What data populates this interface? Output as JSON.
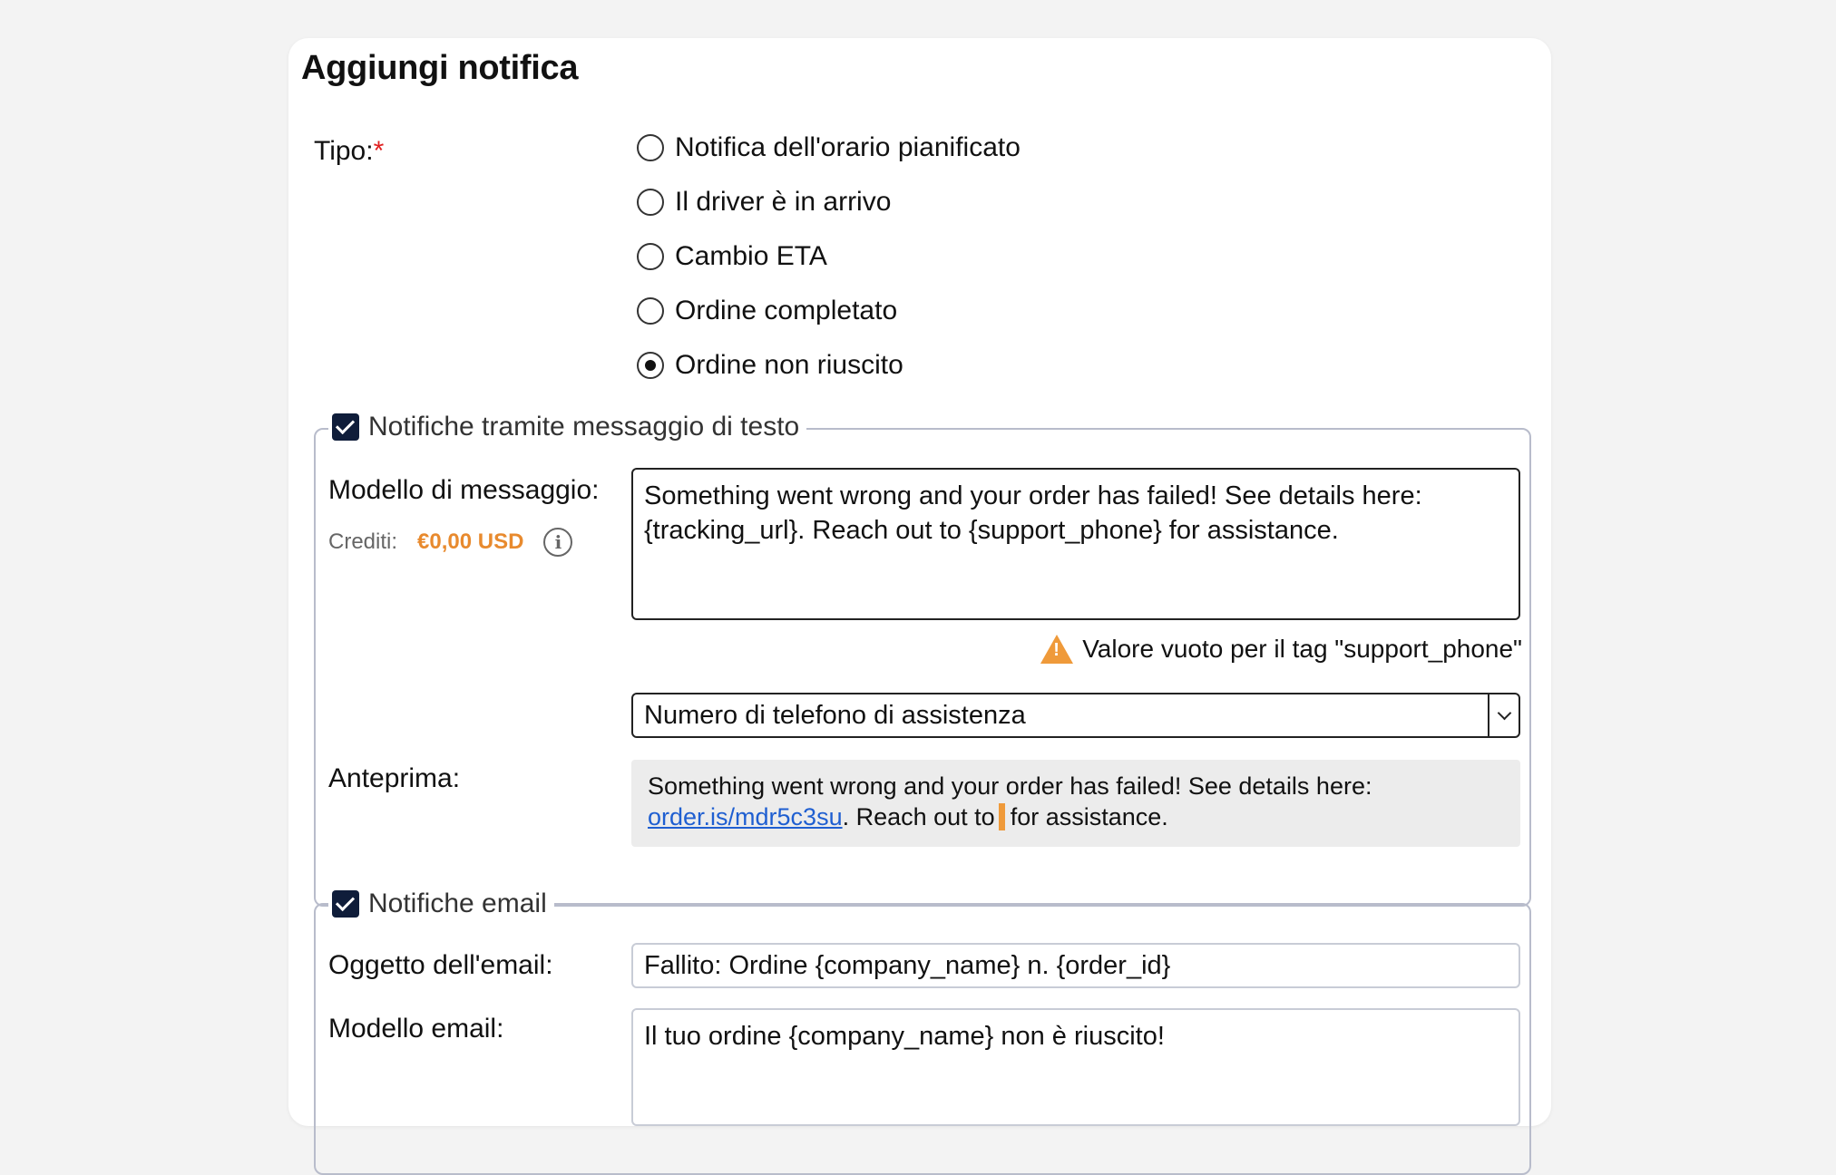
{
  "title": "Aggiungi notifica",
  "type_label": "Tipo:",
  "required_mark": "*",
  "types": [
    {
      "label": "Notifica dell'orario pianificato",
      "checked": false
    },
    {
      "label": "Il driver è in arrivo",
      "checked": false
    },
    {
      "label": "Cambio ETA",
      "checked": false
    },
    {
      "label": "Ordine completato",
      "checked": false
    },
    {
      "label": "Ordine non riuscito",
      "checked": true
    }
  ],
  "sms": {
    "legend": "Notifiche tramite messaggio di testo",
    "enabled": true,
    "template_label": "Modello di messaggio:",
    "template_value": "Something went wrong and your order has failed! See details here: {tracking_url}. Reach out to {support_phone} for assistance.",
    "credits_label": "Crediti:",
    "credits_value": "€0,00 USD",
    "warning_text": "Valore vuoto per il tag \"support_phone\"",
    "tag_select_value": "Numero di telefono di assistenza",
    "preview_label": "Anteprima:",
    "preview_text_before": "Something went wrong and your order has failed! See details here:",
    "preview_link": "order.is/mdr5c3su",
    "preview_text_mid": ". Reach out to",
    "preview_text_after": "for assistance."
  },
  "email": {
    "legend": "Notifiche email",
    "enabled": true,
    "subject_label": "Oggetto dell'email:",
    "subject_value": "Fallito: Ordine {company_name} n. {order_id}",
    "template_label": "Modello email:",
    "template_value": "Il tuo ordine {company_name} non è riuscito!"
  },
  "colors": {
    "accent_orange": "#e88a2e",
    "checkbox_navy": "#0f1d3a",
    "link_blue": "#1f5fd1",
    "required_red": "#e02020"
  }
}
